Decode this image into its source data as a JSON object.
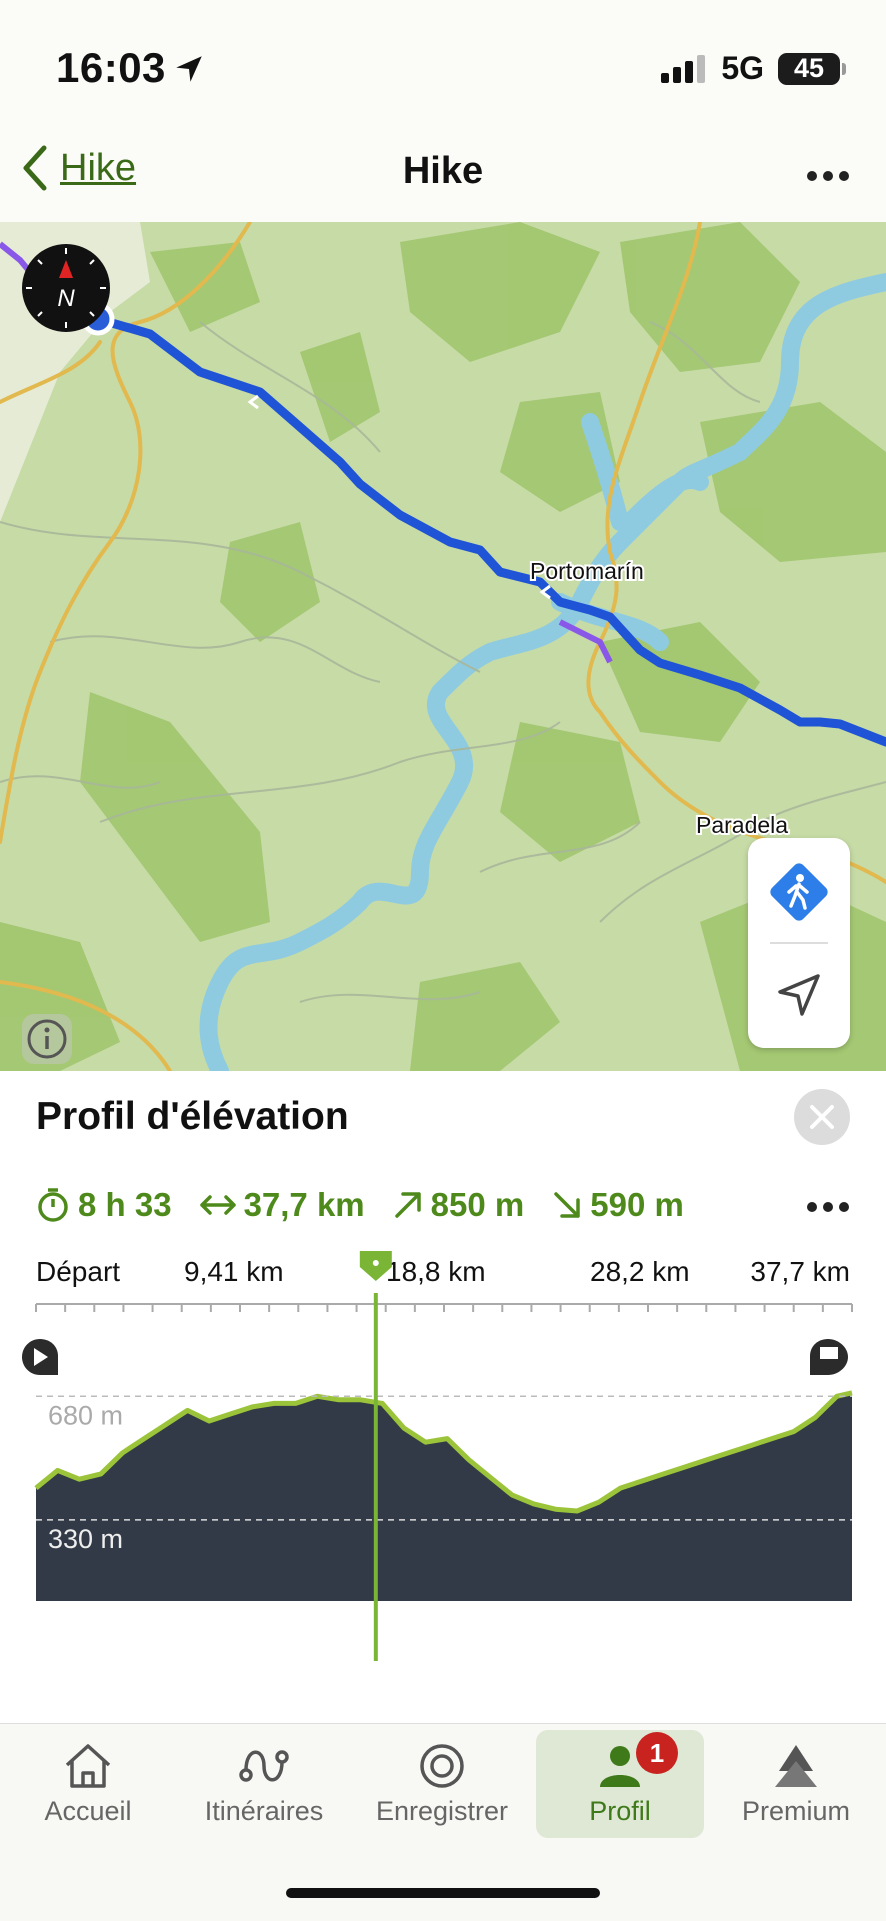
{
  "status_bar": {
    "time": "16:03",
    "network": "5G",
    "battery": "45"
  },
  "nav": {
    "back_label": "Hike",
    "title": "Hike"
  },
  "map": {
    "labels": {
      "portomarin": "Portomarín",
      "paradela": "Paradela"
    },
    "compass_label": "N"
  },
  "elevation": {
    "title": "Profil d'élévation",
    "stats": {
      "duration": "8 h 33",
      "distance": "37,7 km",
      "ascent": "850 m",
      "descent": "590 m"
    },
    "chart_data": {
      "type": "area",
      "x_tick_labels": [
        "Départ",
        "9,41 km",
        "18,8 km",
        "28,2 km",
        "37,7 km"
      ],
      "y_tick_labels": [
        "680 m",
        "330 m"
      ],
      "xlim": [
        0,
        37.7
      ],
      "ylim": [
        100,
        780
      ],
      "series": [
        {
          "x": [
            0,
            1,
            2,
            3,
            4,
            5,
            6,
            7,
            8,
            9,
            10,
            11,
            12,
            13,
            14,
            15,
            16,
            17,
            18,
            19,
            20,
            21,
            22,
            23,
            24,
            25,
            26,
            27,
            28,
            29,
            30,
            31,
            32,
            33,
            34,
            35,
            36,
            37,
            37.7
          ],
          "y": [
            420,
            470,
            445,
            460,
            520,
            560,
            600,
            640,
            610,
            630,
            650,
            660,
            660,
            680,
            670,
            670,
            660,
            590,
            550,
            560,
            500,
            450,
            400,
            375,
            360,
            355,
            380,
            420,
            440,
            460,
            480,
            500,
            520,
            540,
            560,
            580,
            620,
            680,
            690
          ]
        }
      ],
      "cursor_x": 15.7
    }
  },
  "tabs": [
    {
      "label": "Accueil"
    },
    {
      "label": "Itinéraires"
    },
    {
      "label": "Enregistrer"
    },
    {
      "label": "Profil",
      "badge": "1"
    },
    {
      "label": "Premium"
    }
  ]
}
